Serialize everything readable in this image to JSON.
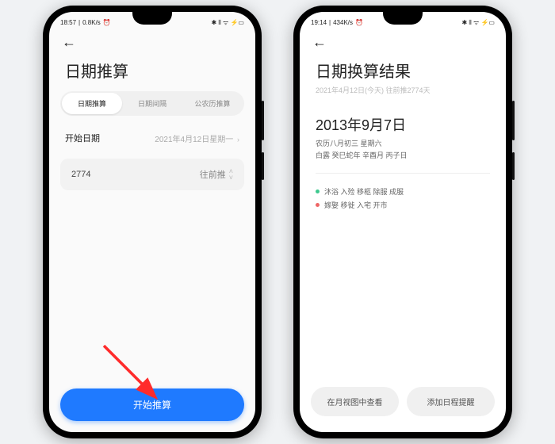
{
  "left": {
    "status": {
      "time": "18:57",
      "net": "0.8K/s",
      "alarm": "⏰",
      "icons": "✱ ⫴ ᯤ ⚡▭"
    },
    "title": "日期推算",
    "tabs": [
      "日期推算",
      "日期间隔",
      "公农历推算"
    ],
    "startLabel": "开始日期",
    "startValue": "2021年4月12日星期一",
    "daysValue": "2774",
    "daysUnit": "往前推",
    "cta": "开始推算"
  },
  "right": {
    "status": {
      "time": "19:14",
      "net": "434K/s",
      "alarm": "⏰",
      "icons": "✱ ⫴ ᯤ ⚡▭"
    },
    "title": "日期换算结果",
    "subtitle": "2021年4月12日(今天) 往前推2774天",
    "resultDate": "2013年9月7日",
    "lunar1": "农历八月初三 星期六",
    "lunar2": "白露 癸巳蛇年 辛酉月 丙子日",
    "goodLabel": "沐浴 入殓 移柩 除服 成服",
    "badLabel": "嫁娶 移徙 入宅 开市",
    "btn1": "在月视图中查看",
    "btn2": "添加日程提醒"
  }
}
